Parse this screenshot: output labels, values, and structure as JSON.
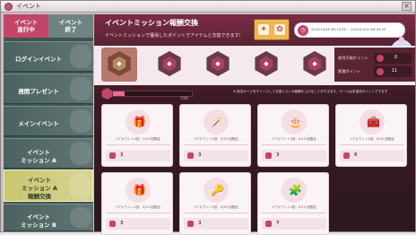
{
  "window": {
    "title": "イベント",
    "close_glyph": "×"
  },
  "sidebar": {
    "tabs": [
      {
        "label_line1": "イベント",
        "label_line2": "進行中",
        "active": true
      },
      {
        "label_line1": "イベント",
        "label_line2": "終了",
        "active": false
      }
    ],
    "items": [
      {
        "label": "ログインイベント"
      },
      {
        "label": "週間プレゼント"
      },
      {
        "label": "メインイベント"
      },
      {
        "label_line1": "イベント",
        "label_line2": "ミッション A"
      },
      {
        "label_line1": "イベント",
        "label_line2": "ミッション A",
        "label_line3": "報酬交換",
        "selected": true
      },
      {
        "label_line1": "イベント",
        "label_line2": "ミッション B"
      }
    ]
  },
  "header": {
    "title": "イベントミッション報酬交換",
    "subtitle": "イベントミッションで獲得したポイントでアイテムと交換できます！",
    "period": "2022/10/26 AM 10:00 ~ 2022/11/02 AM 09:59"
  },
  "points": {
    "used_label": "使用可能ポイント",
    "used_value": "0",
    "total_label": "累積ポイント",
    "total_value": "11"
  },
  "progress": {
    "text": "7/45",
    "fraction": 0.15
  },
  "note": "※ 該当ゲージをチャージして交換リストの報酬を上げることができます。ゲージは未達成ポイントで下ます",
  "rewards": [
    {
      "glyph": "🎁",
      "meta": "1アカウント1回：1/10 回限定",
      "cost": "3"
    },
    {
      "glyph": "🪄",
      "meta": "1アカウント1回：0/20 回限定",
      "cost": "3"
    },
    {
      "glyph": "🎂",
      "meta": "1アカウント1回：0/10 回限定",
      "cost": "3"
    },
    {
      "glyph": "🧰",
      "meta": "1アカウント1回：0/15 回限定",
      "cost": "6"
    },
    {
      "glyph": "🎁",
      "meta": "1アカウント1回：0/15 回限定",
      "cost": "3"
    },
    {
      "glyph": "🔑",
      "meta": "1アカウント1回：0/20 回限定",
      "cost": "3"
    },
    {
      "glyph": "🧩",
      "meta": "1アカウント1回：0/15 回限定",
      "cost": "7"
    }
  ],
  "colors": {
    "accent": "#c3466a",
    "sidebar_bg": "#3e5453",
    "selected": "#c9c66f"
  }
}
